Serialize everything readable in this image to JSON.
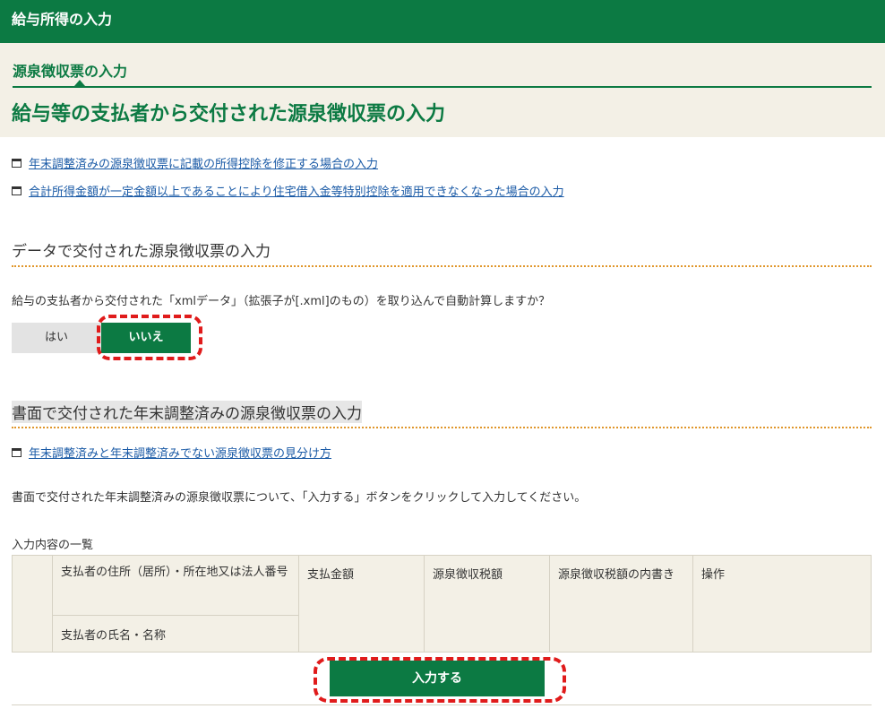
{
  "header": {
    "bar_title": "給与所得の入力",
    "subtitle": "源泉徴収票の入力",
    "main_title": "給与等の支払者から交付された源泉徴収票の入力"
  },
  "links": [
    {
      "label": "年末調整済みの源泉徴収票に記載の所得控除を修正する場合の入力",
      "icon": "window-icon"
    },
    {
      "label": "合計所得金額が一定金額以上であることにより住宅借入金等特別控除を適用できなくなった場合の入力",
      "icon": "window-icon"
    }
  ],
  "data_section": {
    "heading": "データで交付された源泉徴収票の入力",
    "question": "給与の支払者から交付された「xmlデータ」（拡張子が[.xml]のもの）を取り込んで自動計算しますか？",
    "option_yes": "はい",
    "option_no": "いいえ",
    "selected": "いいえ"
  },
  "paper_section": {
    "heading": "書面で交付された年末調整済みの源泉徴収票の入力",
    "link": "年末調整済みと年末調整済みでない源泉徴収票の見分け方",
    "instruction": "書面で交付された年末調整済みの源泉徴収票について、「入力する」ボタンをクリックして入力してください。",
    "list_caption": "入力内容の一覧",
    "table_headers": {
      "payer_address": "支払者の住所（居所）・所在地又は法人番号",
      "payer_name": "支払者の氏名・名称",
      "payment_amount": "支払金額",
      "withholding_tax": "源泉徴収税額",
      "withholding_breakdown": "源泉徴収税額の内書き",
      "operation": "操作"
    },
    "input_button": "入力する"
  },
  "colors": {
    "brand_green": "#0c7a43",
    "header_bg": "#f3f0e6",
    "dotted_accent": "#e0962b",
    "highlight_red": "#e01b1b",
    "link_blue": "#1a5aa6"
  }
}
